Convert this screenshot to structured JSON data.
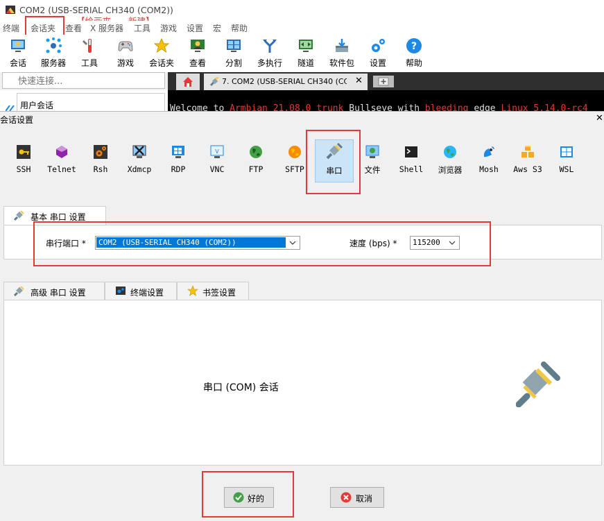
{
  "app": {
    "title": "COM2  (USB-SERIAL CH340 (COM2))",
    "annotation": "【绘画夹——新建】",
    "menu": [
      "终端",
      "会话夹",
      "查看",
      "X 服务器",
      "工具",
      "游戏",
      "设置",
      "宏",
      "帮助"
    ],
    "toolbar": [
      "会话",
      "服务器",
      "工具",
      "游戏",
      "会话夹",
      "查看",
      "分割",
      "多执行",
      "隧道",
      "软件包",
      "设置",
      "帮助"
    ],
    "quick_connect_placeholder": "快速连接...",
    "user_sessions": "用户会话",
    "active_tab": "7. COM2  (USB-SERIAL CH340 (CC",
    "terminal_line": {
      "w1": "Welcome to ",
      "w2": "Armbian 21.08.0 trunk",
      "w3": " Bullseye with ",
      "w4": "bleeding",
      "w5": " edge ",
      "w6": "Linux 5.14.0-rc4"
    }
  },
  "dialog": {
    "title": "会话设置",
    "session_types": [
      "SSH",
      "Telnet",
      "Rsh",
      "Xdmcp",
      "RDP",
      "VNC",
      "FTP",
      "SFTP",
      "串口",
      "文件",
      "Shell",
      "浏览器",
      "Mosh",
      "Aws S3",
      "WSL"
    ],
    "selected_type": "串口",
    "basic_tab": "基本 串口 设置",
    "serial_port_label": "串行端口 *",
    "serial_port_value": "COM2  (USB-SERIAL CH340 (COM2))",
    "speed_label": "速度 (bps) *",
    "speed_value": "115200",
    "lower_tabs": [
      "高级 串口 设置",
      "终端设置",
      "书签设置"
    ],
    "session_desc": "串口 (COM) 会话",
    "ok_button": "好的",
    "cancel_button": "取消"
  },
  "colors": {
    "highlight_red": "#e53935",
    "selection_blue": "#cce4f7",
    "select_blue": "#0078d7",
    "ok_green": "#43a047",
    "cancel_red": "#e53935"
  }
}
